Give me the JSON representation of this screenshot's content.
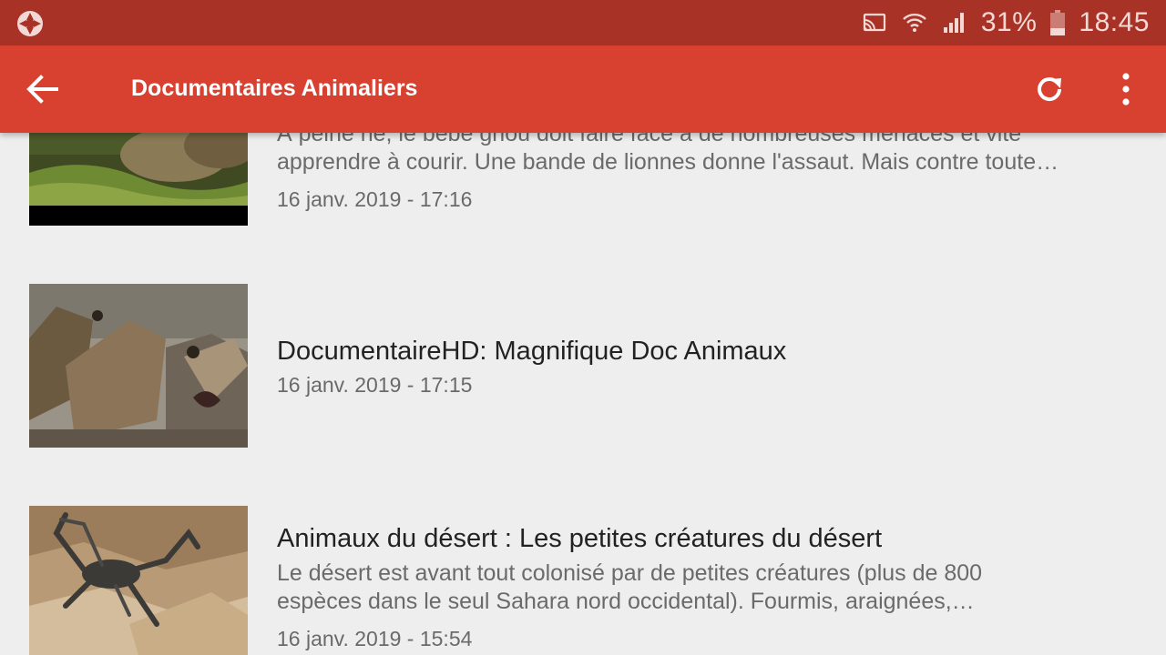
{
  "status_bar": {
    "battery_percent": "31%",
    "time": "18:45",
    "icons": [
      "app-aperture-icon",
      "cast-icon",
      "wifi-icon",
      "signal-icon",
      "battery-icon"
    ]
  },
  "toolbar": {
    "title": "Documentaires Animaliers",
    "icons": [
      "back-arrow-icon",
      "refresh-icon",
      "more-vert-icon"
    ]
  },
  "videos": [
    {
      "title": "",
      "desc_line1": "À peine né, le bébé gnou doit faire face à de nombreuses menaces et vite",
      "desc_line2": "apprendre à courir. Une bande de lionnes donne l'assaut. Mais contre toute…",
      "date": "16 janv. 2019 - 17:16"
    },
    {
      "title": "DocumentaireHD: Magnifique Doc Animaux",
      "date": "16 janv. 2019 - 17:15"
    },
    {
      "title": "Animaux du désert : Les petites créatures du désert",
      "desc_line1": "Le désert est avant tout colonisé par de petites créatures (plus de 800",
      "desc_line2": "espèces dans le seul Sahara nord occidental). Fourmis, araignées,…",
      "date": "16 janv. 2019 - 15:54"
    }
  ],
  "colors": {
    "status_bar": "#a93226",
    "toolbar": "#d84130",
    "background": "#eeeeee"
  }
}
